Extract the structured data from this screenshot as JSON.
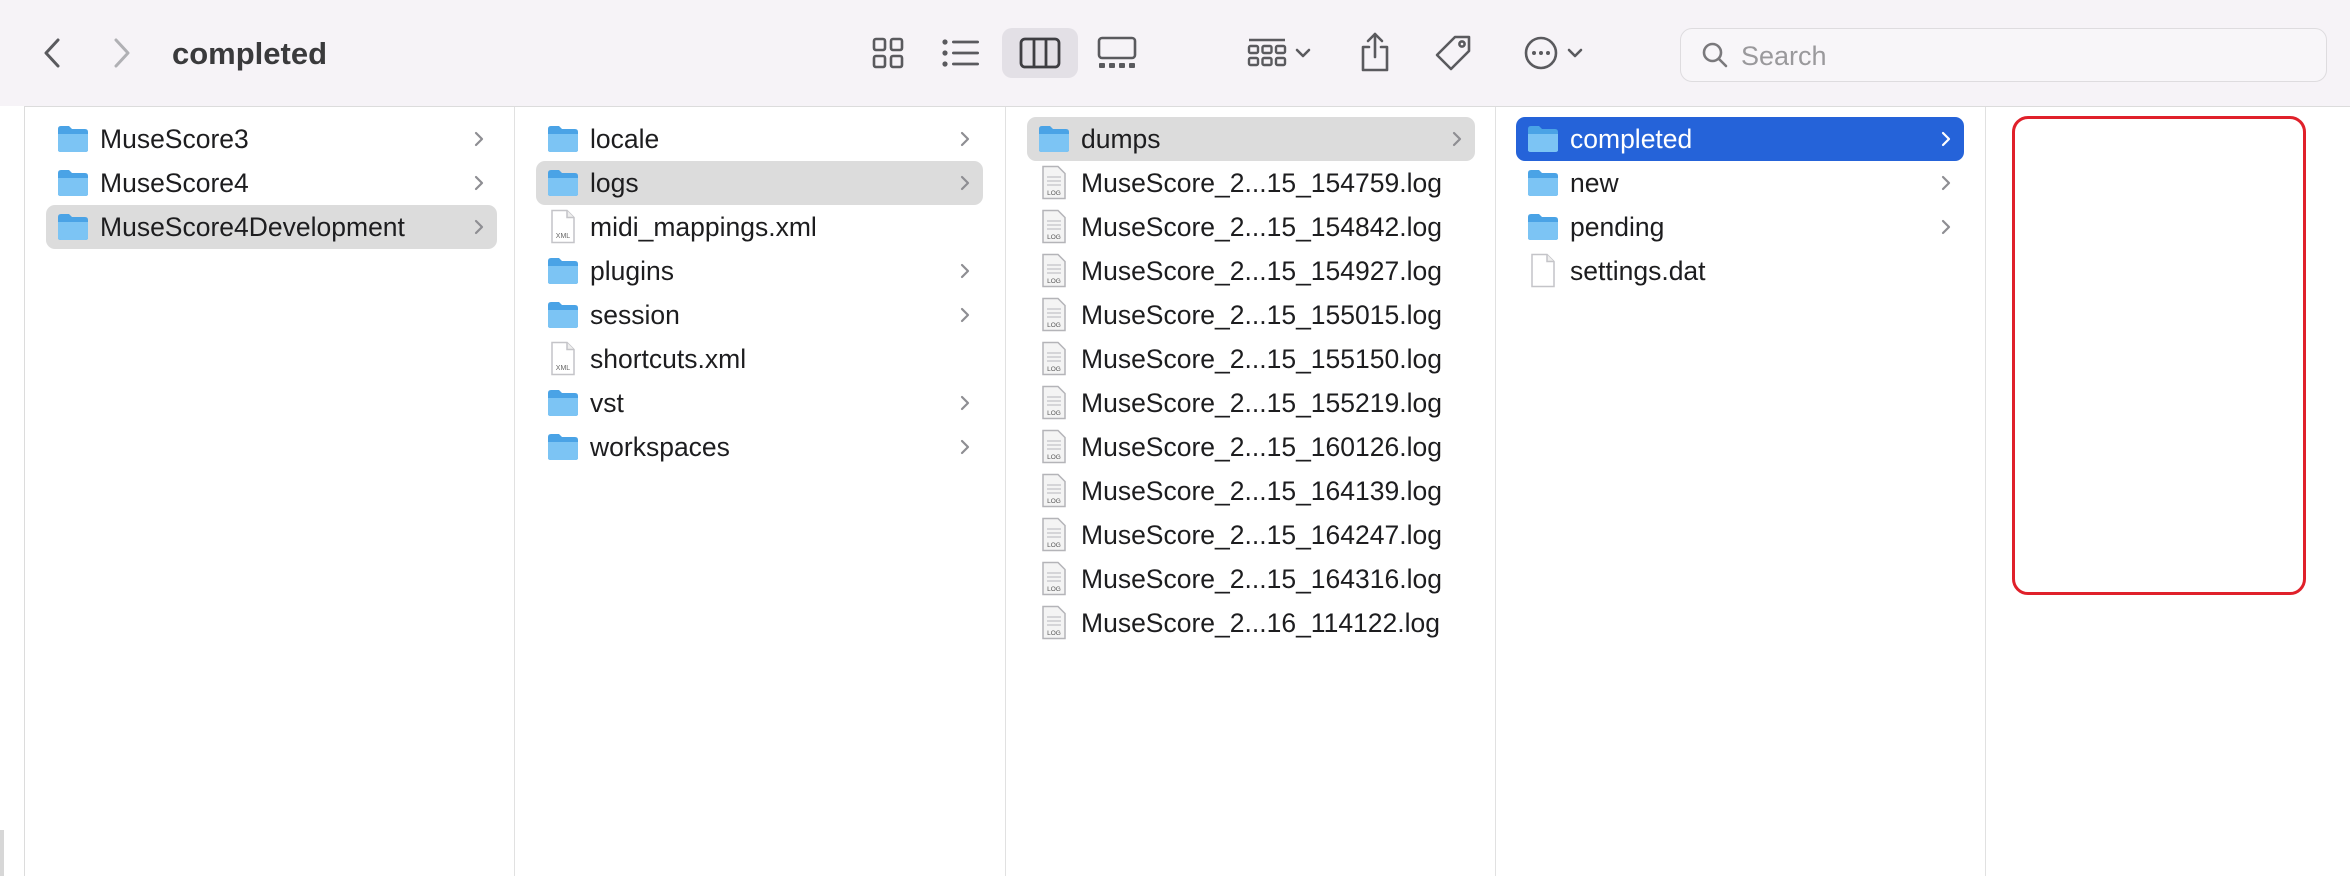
{
  "window": {
    "title": "completed"
  },
  "toolbar": {
    "back_icon": "chevron-left-icon",
    "forward_icon": "chevron-right-icon",
    "view_icons": "icon-view-icon",
    "view_list": "list-view-icon",
    "view_columns": "column-view-icon",
    "view_gallery": "gallery-view-icon",
    "group_icon": "group-by-icon",
    "share_icon": "share-icon",
    "tag_icon": "tag-icon",
    "more_icon": "more-actions-icon"
  },
  "search": {
    "placeholder": "Search",
    "value": ""
  },
  "columns": [
    {
      "items": [
        {
          "label": "MuseScore3",
          "type": "folder"
        },
        {
          "label": "MuseScore4",
          "type": "folder"
        },
        {
          "label": "MuseScore4Development",
          "type": "folder"
        }
      ]
    },
    {
      "items": [
        {
          "label": "locale",
          "type": "folder"
        },
        {
          "label": "logs",
          "type": "folder"
        },
        {
          "label": "midi_mappings.xml",
          "type": "xml"
        },
        {
          "label": "plugins",
          "type": "folder"
        },
        {
          "label": "session",
          "type": "folder"
        },
        {
          "label": "shortcuts.xml",
          "type": "xml"
        },
        {
          "label": "vst",
          "type": "folder"
        },
        {
          "label": "workspaces",
          "type": "folder"
        }
      ]
    },
    {
      "items": [
        {
          "label": "dumps",
          "type": "folder"
        },
        {
          "label": "MuseScore_2...15_154759.log",
          "type": "log"
        },
        {
          "label": "MuseScore_2...15_154842.log",
          "type": "log"
        },
        {
          "label": "MuseScore_2...15_154927.log",
          "type": "log"
        },
        {
          "label": "MuseScore_2...15_155015.log",
          "type": "log"
        },
        {
          "label": "MuseScore_2...15_155150.log",
          "type": "log"
        },
        {
          "label": "MuseScore_2...15_155219.log",
          "type": "log"
        },
        {
          "label": "MuseScore_2...15_160126.log",
          "type": "log"
        },
        {
          "label": "MuseScore_2...15_164139.log",
          "type": "log"
        },
        {
          "label": "MuseScore_2...15_164247.log",
          "type": "log"
        },
        {
          "label": "MuseScore_2...15_164316.log",
          "type": "log"
        },
        {
          "label": "MuseScore_2...16_114122.log",
          "type": "log"
        }
      ]
    },
    {
      "items": [
        {
          "label": "completed",
          "type": "folder"
        },
        {
          "label": "new",
          "type": "folder"
        },
        {
          "label": "pending",
          "type": "folder"
        },
        {
          "label": "settings.dat",
          "type": "file"
        }
      ]
    }
  ],
  "badges": {
    "xml": "XML",
    "log": "LOG"
  },
  "colors": {
    "selection_blue": "#2563d9",
    "selection_grey": "#dcdcdc",
    "folder_blue": "#5fb3ec",
    "highlight_red": "#e0202a"
  }
}
